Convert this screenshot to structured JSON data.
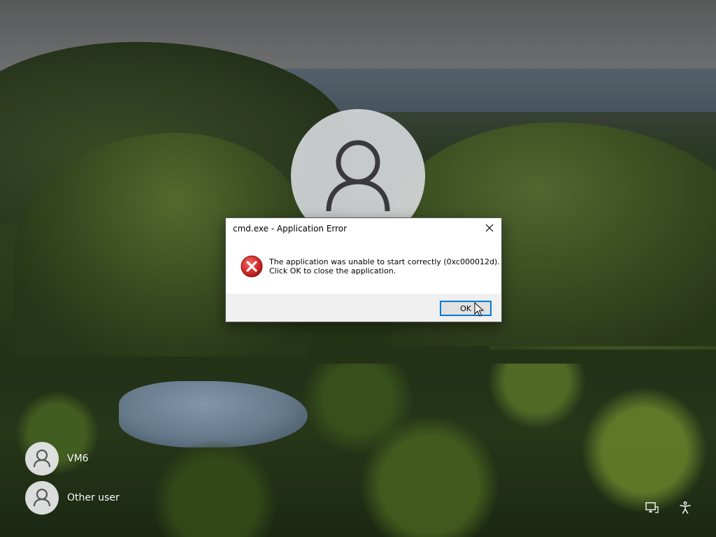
{
  "dialog": {
    "title": "cmd.exe - Application Error",
    "message_line1": "The application was unable to start correctly (0xc000012d).",
    "message_line2": "Click OK to close the application.",
    "ok_label": "OK",
    "icon": "error-icon",
    "close_icon": "close-icon"
  },
  "users": [
    {
      "name": "VM6",
      "icon": "user-icon"
    },
    {
      "name": "Other user",
      "icon": "user-icon"
    }
  ],
  "tray": {
    "network_icon": "network-icon",
    "accessibility_icon": "accessibility-icon"
  },
  "colors": {
    "accent": "#0078d7",
    "error_red": "#d42c2c"
  }
}
